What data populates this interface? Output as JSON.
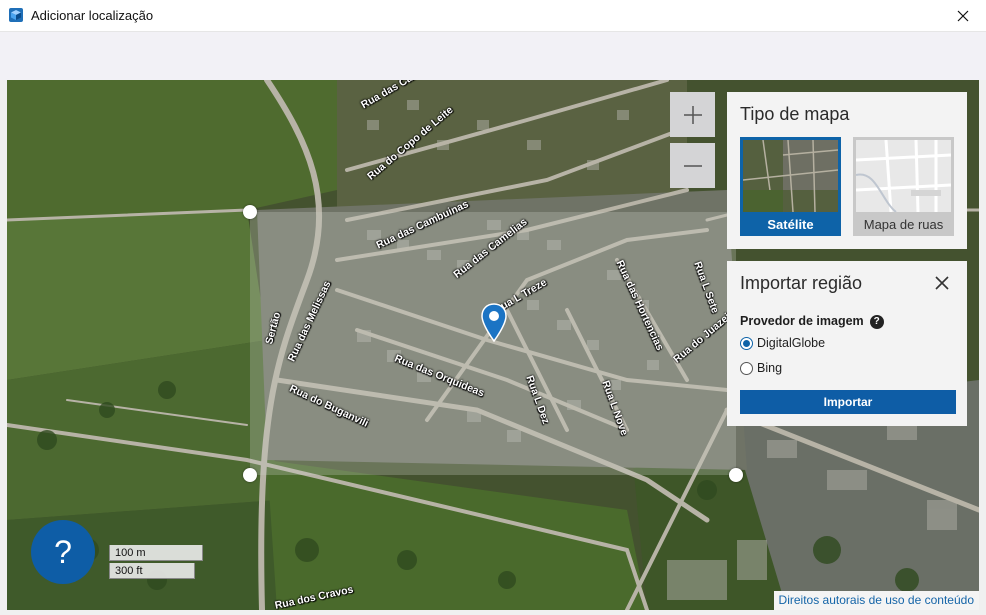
{
  "window": {
    "title": "Adicionar localização",
    "close_icon": "close-icon",
    "app_icon": "3d-box-icon"
  },
  "map": {
    "zoom_in_icon": "plus-icon",
    "zoom_out_icon": "minus-icon",
    "marker_icon": "map-pin-icon",
    "streets": [
      "Rua das Camelias",
      "Rua do Copo de Leite",
      "Rua das Cambuinas",
      "Rua das Camelias",
      "Rua L Treze",
      "Rua das Melissas",
      "Sertão",
      "Rua das Orquideas",
      "Rua do Buganvili",
      "Rua L Dez",
      "Rua L Nove",
      "Rua das Hortencias",
      "Rua L Sete",
      "Rua do Juazeiro",
      "Rua dos Cravos"
    ],
    "scale": {
      "metric": "100 m",
      "imperial": "300 ft"
    },
    "help_label": "?",
    "copyright": "Direitos autorais de uso de conteúdo"
  },
  "map_type": {
    "title": "Tipo de mapa",
    "options": [
      {
        "label": "Satélite",
        "selected": true
      },
      {
        "label": "Mapa de ruas",
        "selected": false
      }
    ]
  },
  "import_region": {
    "title": "Importar região",
    "close_icon": "close-icon",
    "provider_label": "Provedor de imagem",
    "provider_help": "?",
    "providers": [
      {
        "label": "DigitalGlobe",
        "selected": true
      },
      {
        "label": "Bing",
        "selected": false
      }
    ],
    "import_button": "Importar"
  },
  "colors": {
    "accent": "#0e5da6",
    "satellite_selected": "#0e63a8"
  }
}
